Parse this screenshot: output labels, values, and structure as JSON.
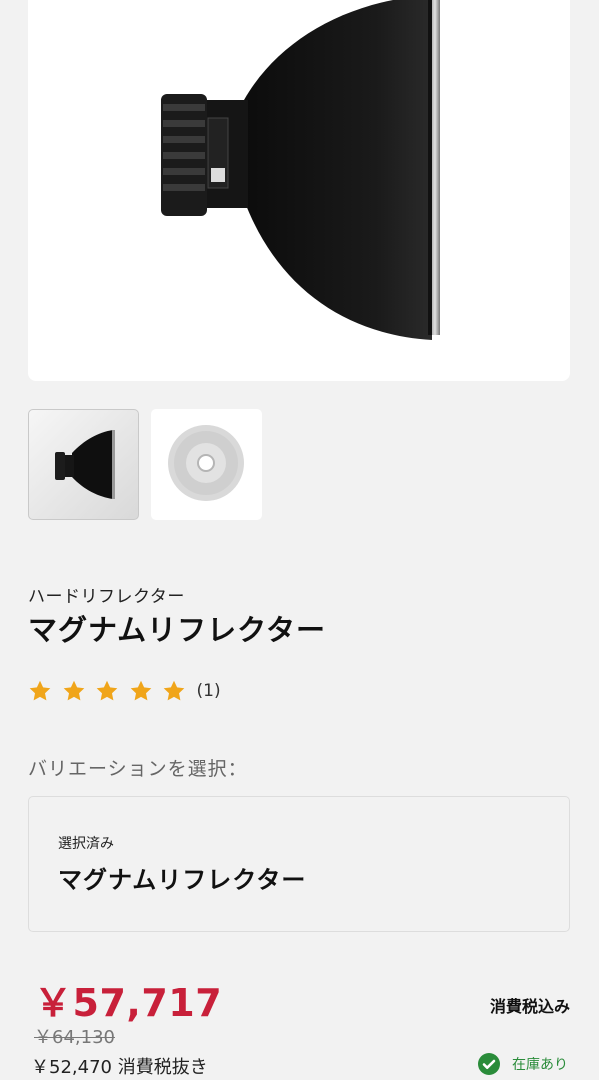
{
  "product": {
    "category": "ハードリフレクター",
    "title": "マグナムリフレクター",
    "rating": {
      "stars": 5,
      "count": "(1)"
    },
    "brand_color": "#c8203a"
  },
  "gallery": {
    "thumbnails": [
      {
        "name": "reflector-side-view",
        "selected": true
      },
      {
        "name": "reflector-front-view",
        "selected": false
      }
    ]
  },
  "variation": {
    "label": "バリエーションを選択：",
    "selected_caption": "選択済み",
    "selected_value": "マグナムリフレクター"
  },
  "pricing": {
    "price": "￥57,717",
    "original_price": "￥64,130",
    "net_price": "￥52,470 消費税抜き",
    "tax_label": "消費税込み"
  },
  "stock": {
    "label": "在庫あり",
    "color": "#2a8c3a",
    "icon": "check-circle-icon"
  }
}
